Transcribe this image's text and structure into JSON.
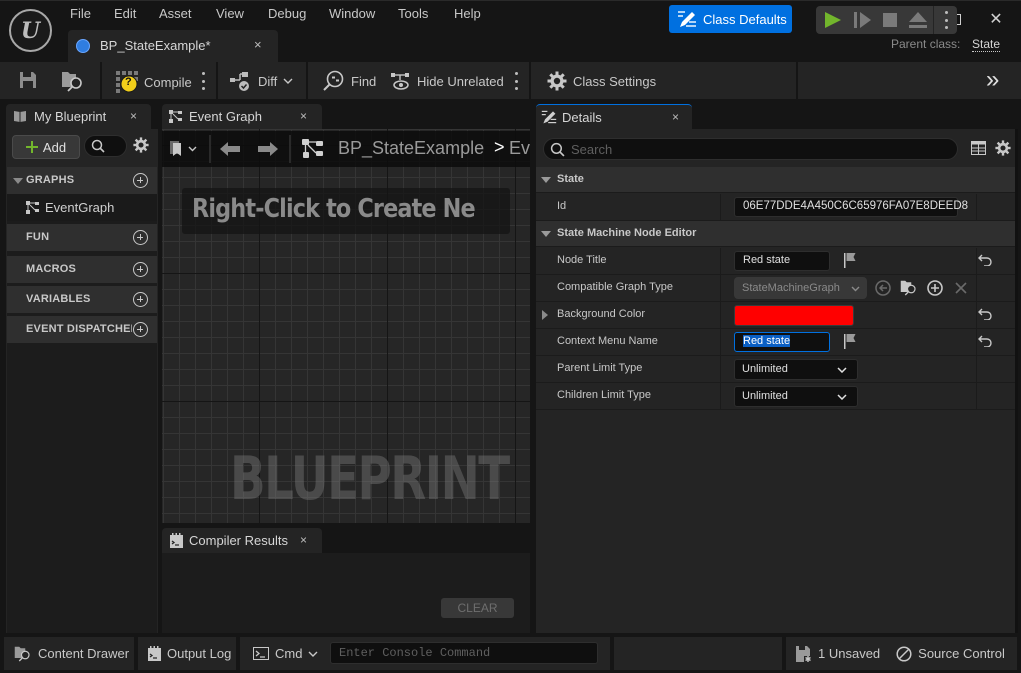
{
  "app": {
    "logo_glyph": "U",
    "menu": [
      "File",
      "Edit",
      "Asset",
      "View",
      "Debug",
      "Window",
      "Tools",
      "Help"
    ],
    "document_tab": {
      "label": "BP_StateExample*",
      "close": "×"
    },
    "window_controls": {
      "minimize": "—",
      "maximize": "☐",
      "close": "✕"
    },
    "parent_class_label": "Parent class:",
    "parent_class_value": "State"
  },
  "toolbar": {
    "compile_label": "Compile",
    "compile_status": "?",
    "diff_label": "Diff",
    "find_label": "Find",
    "hide_unrelated_label": "Hide Unrelated",
    "class_settings_label": "Class Settings",
    "class_defaults_label": "Class Defaults",
    "overflow_glyph": "»",
    "colors": {
      "accent": "#0070e0",
      "play": "#72b62c",
      "compile_warning": "#f2cf1a"
    }
  },
  "my_blueprint": {
    "tab_label": "My Blueprint",
    "close": "×",
    "add_label": "Add",
    "sections": [
      {
        "label": "GRAPHS",
        "expanded": true,
        "items": [
          "EventGraph"
        ]
      },
      {
        "label": "FUN",
        "expanded": false,
        "items": []
      },
      {
        "label": "MACROS",
        "expanded": false,
        "items": []
      },
      {
        "label": "VARIABLES",
        "expanded": false,
        "items": []
      },
      {
        "label": "EVENT DISPATCHERS",
        "expanded": false,
        "items": []
      }
    ]
  },
  "event_graph": {
    "tab_label": "Event Graph",
    "close": "×",
    "breadcrumb": [
      "BP_StateExample",
      "Ev"
    ],
    "breadcrumb_sep": ">",
    "hint": "Right-Click to Create Ne",
    "watermark": "BLUEPRINT"
  },
  "compiler_results": {
    "tab_label": "Compiler Results",
    "close": "×",
    "clear_label": "CLEAR"
  },
  "details": {
    "tab_label": "Details",
    "close": "×",
    "search_placeholder": "Search",
    "categories": [
      {
        "label": "State"
      },
      {
        "label": "State Machine Node Editor"
      }
    ],
    "properties": {
      "id": {
        "label": "Id",
        "value": "06E77DDE4A450C6C65976FA07E8DEED8"
      },
      "node_title": {
        "label": "Node Title",
        "value": "Red state"
      },
      "compatible_graph_type": {
        "label": "Compatible Graph Type",
        "value": "StateMachineGraph"
      },
      "background_color": {
        "label": "Background Color",
        "value": "#ff0000"
      },
      "context_menu_name": {
        "label": "Context Menu Name",
        "value": "Red state"
      },
      "parent_limit_type": {
        "label": "Parent Limit Type",
        "value": "Unlimited"
      },
      "children_limit_type": {
        "label": "Children Limit Type",
        "value": "Unlimited"
      }
    }
  },
  "statusbar": {
    "content_drawer": "Content Drawer",
    "output_log": "Output Log",
    "cmd_label": "Cmd",
    "console_placeholder": "Enter Console Command",
    "unsaved": "1 Unsaved",
    "source_control": "Source Control"
  }
}
